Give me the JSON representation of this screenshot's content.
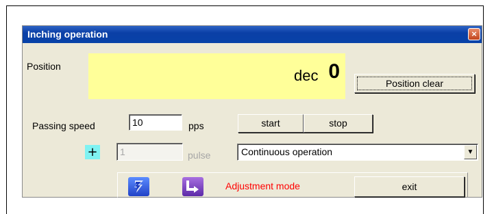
{
  "window": {
    "title": "Inching operation",
    "close_glyph": "×"
  },
  "position": {
    "label": "Position",
    "value": "0",
    "unit": "dec",
    "clear_button": "Position clear"
  },
  "speed": {
    "label": "Passing speed",
    "value": "10",
    "unit": "pps"
  },
  "buttons": {
    "start": "start",
    "stop": "stop",
    "exit": "exit"
  },
  "pulse": {
    "plus_label": "+",
    "value": "1",
    "unit": "pulse"
  },
  "mode_select": {
    "selected": "Continuous operation",
    "arrow": "▼"
  },
  "mode_icons": {
    "icon1": "lightning-icon",
    "icon2": "return-arrow-icon"
  },
  "adjustment": {
    "label": "Adjustment mode",
    "color": "#ff0000"
  },
  "colors": {
    "title_bar": "#0a3fa6",
    "position_display": "#ffff99",
    "plus_button": "#7ff2f2"
  }
}
